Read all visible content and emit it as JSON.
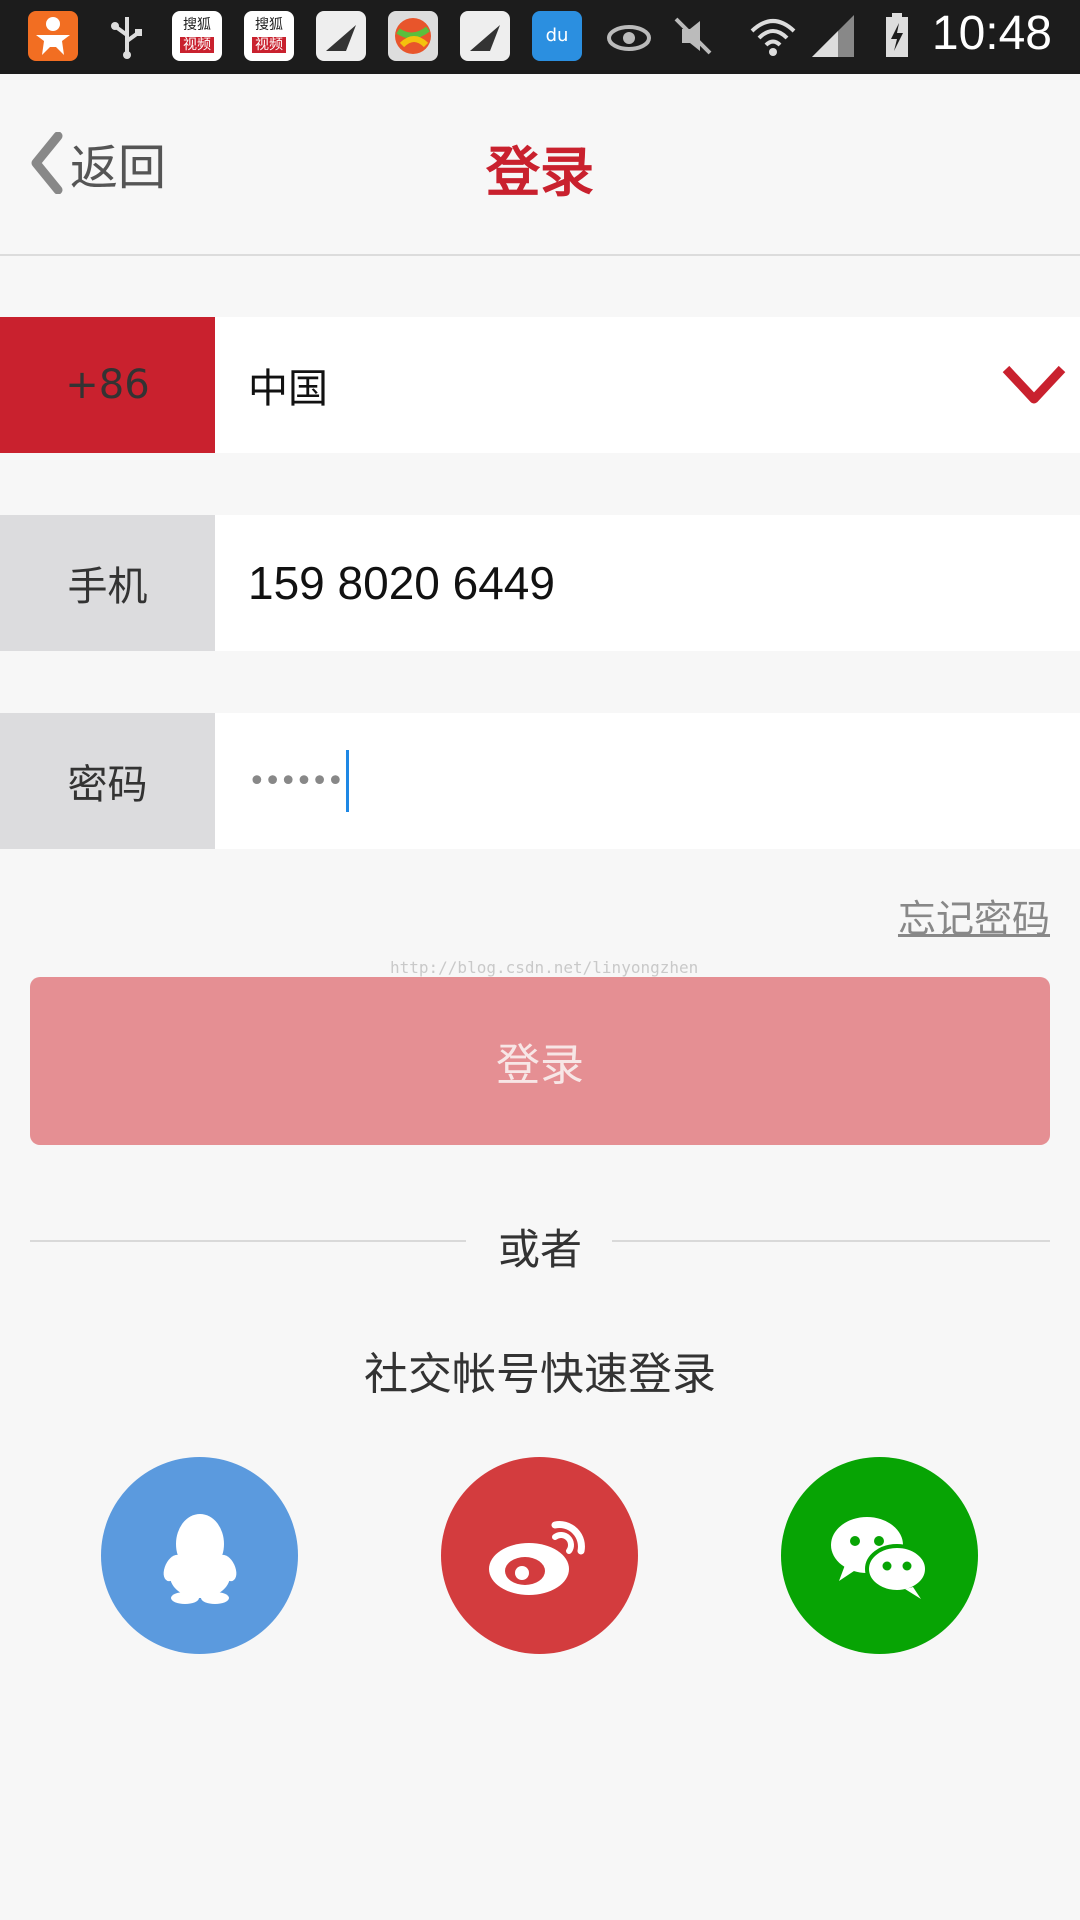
{
  "status_bar": {
    "time": "10:48",
    "icons": [
      "app-icon",
      "usb-icon",
      "sohu-video-icon",
      "sohu-video-icon",
      "sail-icon",
      "ball-app-icon",
      "sail-icon",
      "baidu-cloud-icon",
      "eye-icon",
      "mute-icon",
      "wifi-icon",
      "signal-icon",
      "battery-charging-icon"
    ],
    "sohu_label_top": "搜狐",
    "sohu_label_bottom": "视频",
    "baidu_label": "du"
  },
  "header": {
    "back_label": "返回",
    "title": "登录"
  },
  "country_row": {
    "code": "+86",
    "country": "中国",
    "arrow_icon": "chevron-down-icon"
  },
  "phone_row": {
    "label": "手机",
    "value": "159 8020 6449"
  },
  "password_row": {
    "label": "密码",
    "value": "••••••"
  },
  "forgot_password": "忘记密码",
  "watermark": "http://blog.csdn.net/linyongzhen",
  "login_button": "登录",
  "divider_text": "或者",
  "social_title": "社交帐号快速登录",
  "social_buttons": [
    "qq-icon",
    "weibo-icon",
    "wechat-icon"
  ],
  "colors": {
    "brand_red": "#c9212e",
    "login_button_disabled": "#e58f93",
    "qq_blue": "#5b9ade",
    "weibo_red": "#d33c3e",
    "wechat_green": "#07a404",
    "caret_blue": "#1e88e5"
  }
}
